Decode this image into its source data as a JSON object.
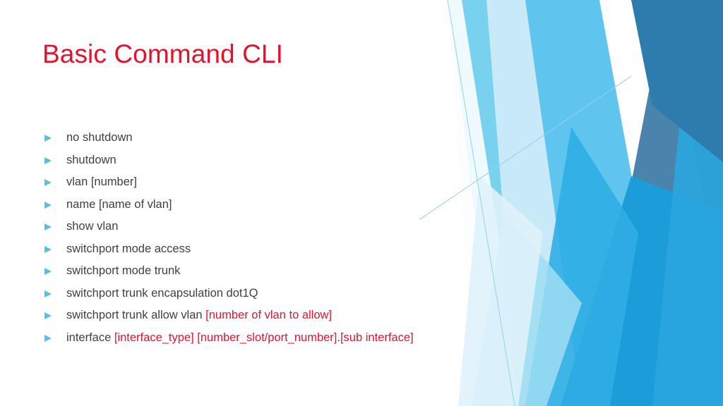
{
  "slide": {
    "title": "Basic Command CLI",
    "title_color": "#E8112D",
    "body_color": "#404040",
    "background_color": "#FFFFFF",
    "bullet_marker_color": "#4FC3E8",
    "accent_colors": {
      "pale_blue": "#CFEAF8",
      "light_blue": "#79D1F0",
      "sky_blue": "#5FC5EE",
      "mid_blue": "#2FAEE4",
      "bright_blue": "#1C9CD8",
      "deep_blue": "#2E7BAD",
      "hairline": "#8FD3EC"
    },
    "bullets": [
      {
        "text": "no shutdown",
        "highlight": ""
      },
      {
        "text": "shutdown",
        "highlight": ""
      },
      {
        "text": "vlan [number]",
        "highlight": ""
      },
      {
        "text": "name [name of vlan]",
        "highlight": ""
      },
      {
        "text": "show vlan",
        "highlight": ""
      },
      {
        "text": "switchport mode access",
        "highlight": ""
      },
      {
        "text": "switchport mode trunk",
        "highlight": ""
      },
      {
        "text": "switchport trunk encapsulation dot1Q",
        "highlight": ""
      },
      {
        "text": "switchport trunk allow vlan ",
        "highlight": "[number of vlan to allow]"
      },
      {
        "text": "interface ",
        "highlight": "[interface_type] [number_slot/port_number].[sub interface]"
      }
    ]
  }
}
